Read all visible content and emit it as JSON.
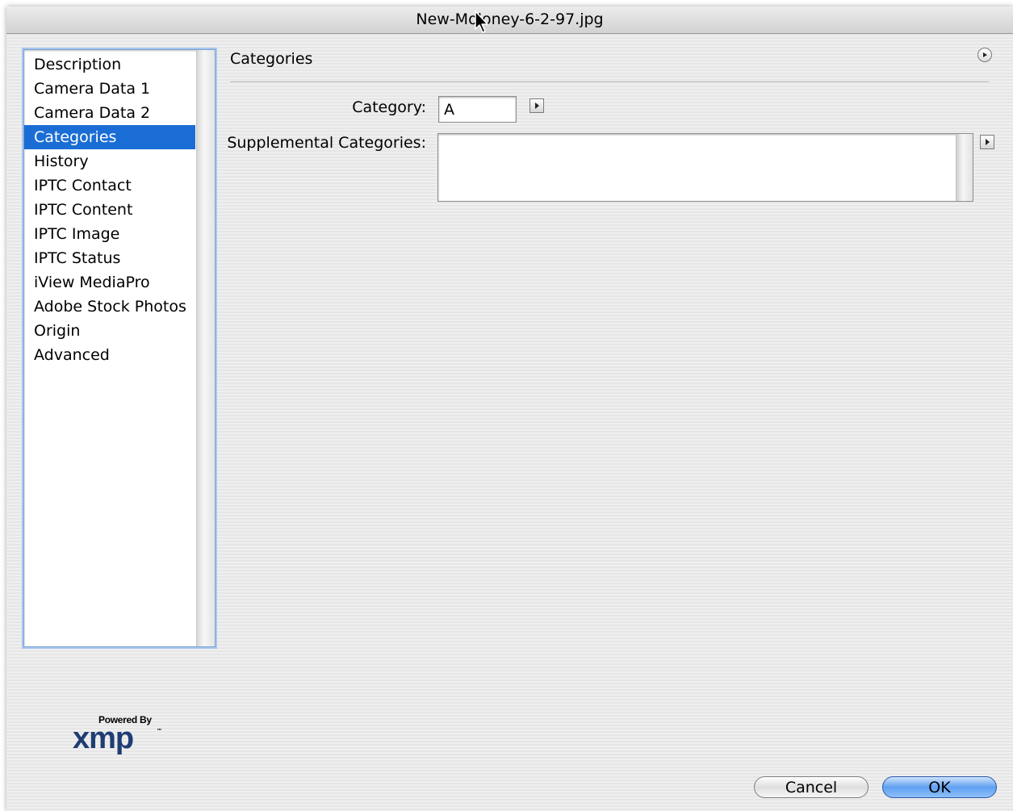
{
  "window": {
    "title": "New-Moloney-6-2-97.jpg"
  },
  "sidebar": {
    "items": [
      {
        "label": "Description",
        "selected": false
      },
      {
        "label": "Camera Data 1",
        "selected": false
      },
      {
        "label": "Camera Data 2",
        "selected": false
      },
      {
        "label": "Categories",
        "selected": true
      },
      {
        "label": "History",
        "selected": false
      },
      {
        "label": "IPTC Contact",
        "selected": false
      },
      {
        "label": "IPTC Content",
        "selected": false
      },
      {
        "label": "IPTC Image",
        "selected": false
      },
      {
        "label": "IPTC Status",
        "selected": false
      },
      {
        "label": "iView MediaPro",
        "selected": false
      },
      {
        "label": "Adobe Stock Photos",
        "selected": false
      },
      {
        "label": "Origin",
        "selected": false
      },
      {
        "label": "Advanced",
        "selected": false
      }
    ]
  },
  "panel": {
    "title": "Categories",
    "category_label": "Category:",
    "category_value": "A",
    "supplemental_label": "Supplemental Categories:",
    "supplemental_value": ""
  },
  "branding": {
    "powered_by": "Powered By",
    "logo": "xmp",
    "trademark": "™"
  },
  "buttons": {
    "cancel": "Cancel",
    "ok": "OK"
  },
  "colors": {
    "selection": "#1a6dd4",
    "ok_button": "#5fa0f0"
  }
}
